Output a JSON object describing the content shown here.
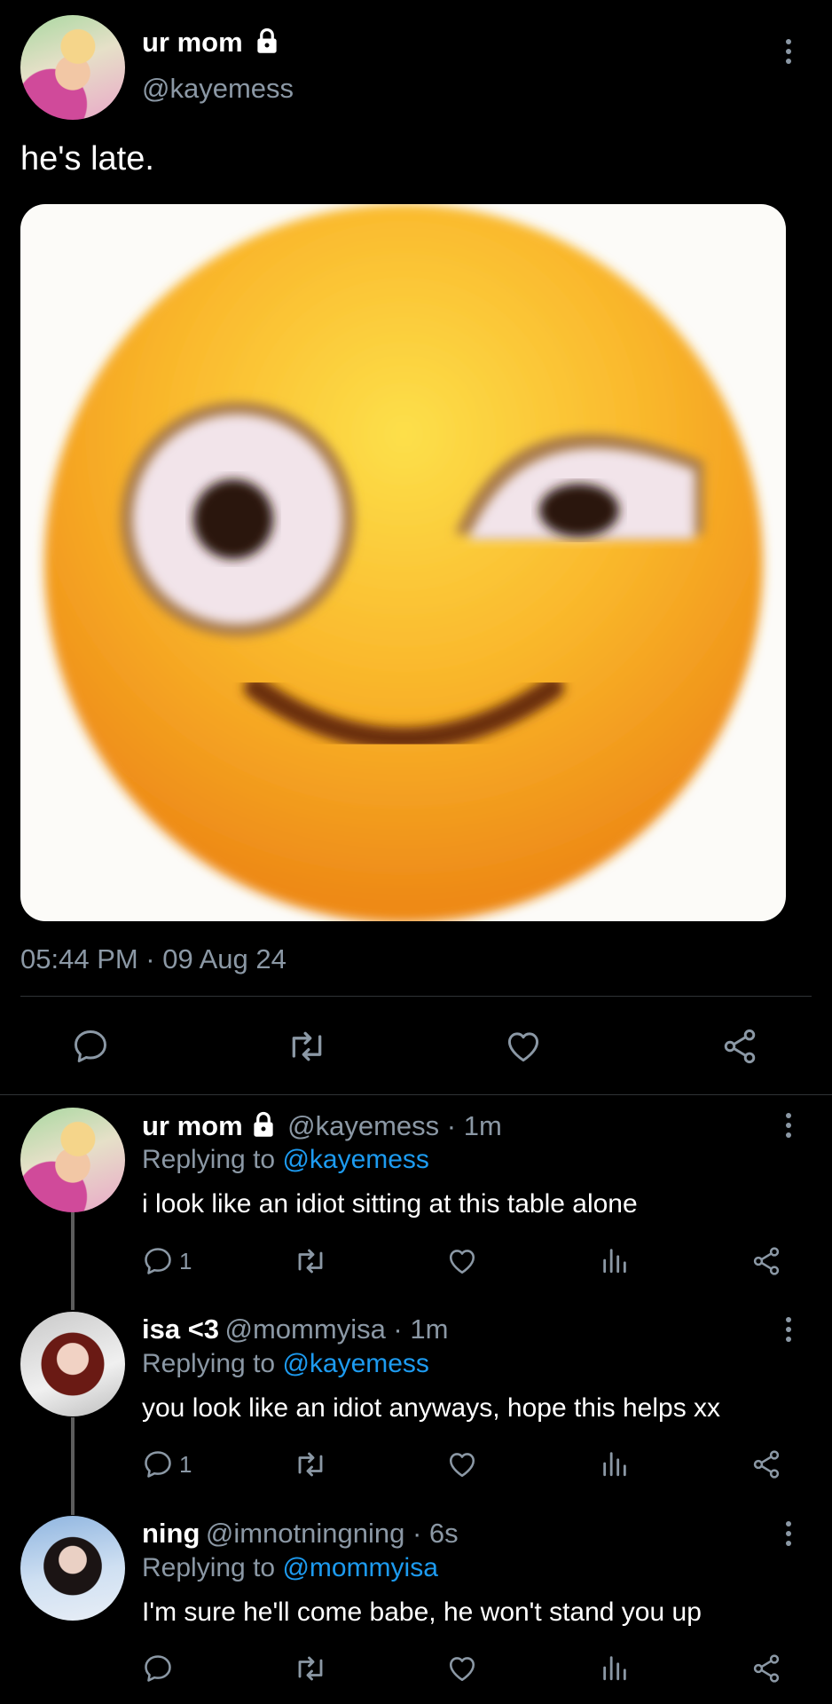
{
  "main_tweet": {
    "display_name": "ur mom",
    "handle": "@kayemess",
    "text": "he's late.",
    "timestamp": "05:44 PM · 09 Aug 24",
    "media": "smirking-emoji-image"
  },
  "replies": [
    {
      "display_name": "ur mom",
      "meta": "@kayemess · 1m",
      "replying_prefix": "Replying to ",
      "replying_to": "@kayemess",
      "text": "i look like an idiot sitting at this table alone",
      "reply_count": "1"
    },
    {
      "display_name": "isa <3",
      "meta": "@mommyisa · 1m",
      "replying_prefix": "Replying to ",
      "replying_to": "@kayemess",
      "text": "you look like an idiot anyways, hope this helps xx",
      "reply_count": "1"
    },
    {
      "display_name": "ning",
      "meta": "@imnotningning · 6s",
      "replying_prefix": "Replying to ",
      "replying_to": "@mommyisa",
      "text": "I'm sure he'll come babe, he won't stand you up",
      "reply_count": ""
    }
  ],
  "colors": {
    "background": "#000000",
    "secondary_text": "#8b98a5",
    "link": "#1d9bf0",
    "divider": "#2f3336"
  }
}
